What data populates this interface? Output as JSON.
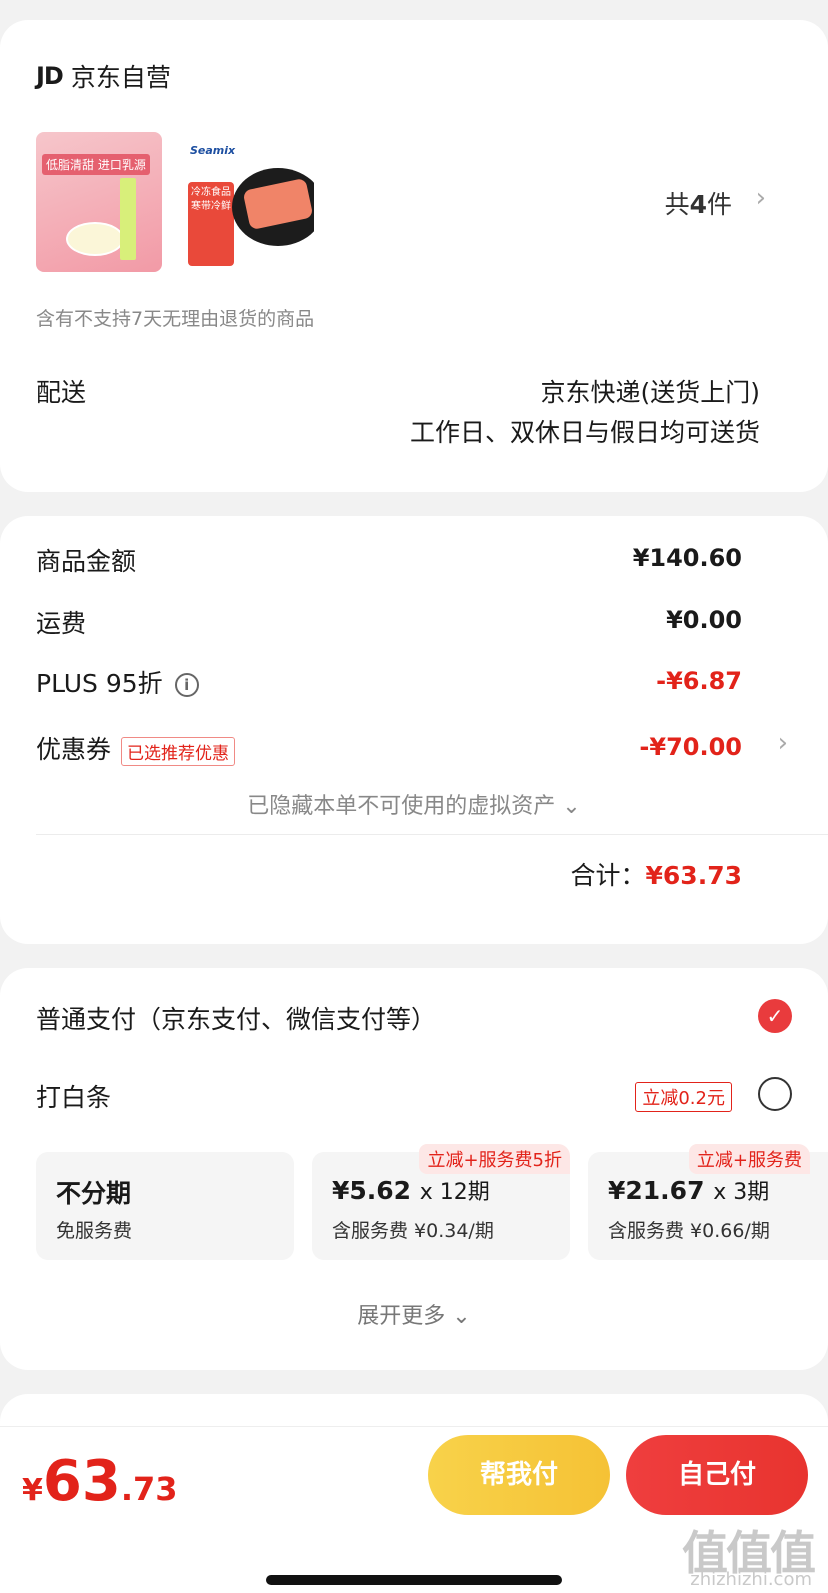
{
  "shop": {
    "logo": "JD",
    "name": "京东自营",
    "thumb1_text": "低脂清甜 进口乳源",
    "thumb2_brand": "Seamix",
    "thumb2_text": "冷冻食品 寒带冷鲜",
    "item_count_prefix": "共",
    "item_count": "4",
    "item_count_suffix": "件",
    "notice": "含有不支持7天无理由退货的商品",
    "shipping_label": "配送",
    "shipping_method": "京东快递(送货上门)",
    "shipping_time": "工作日、双休日与假日均可送货"
  },
  "price": {
    "goods_label": "商品金额",
    "goods_value": "¥140.60",
    "freight_label": "运费",
    "freight_value": "¥0.00",
    "plus_label": "PLUS 95折",
    "plus_value": "-¥6.87",
    "coupon_label": "优惠券",
    "coupon_tag": "已选推荐优惠",
    "coupon_value": "-¥70.00",
    "hidden_assets": "已隐藏本单不可使用的虚拟资产 ⌄",
    "total_label": "合计：",
    "total_value": "¥63.73"
  },
  "payment": {
    "normal_label": "普通支付（京东支付、微信支付等）",
    "baitiao_label": "打白条",
    "baitiao_tag": "立减0.2元",
    "plans": [
      {
        "main": "不分期",
        "sub": "免服务费",
        "badge": ""
      },
      {
        "main": "¥5.62",
        "times": "x 12期",
        "sub": "含服务费 ¥0.34/期",
        "badge": "立减+服务费5折"
      },
      {
        "main": "¥21.67",
        "times": "x 3期",
        "sub": "含服务费 ¥0.66/期",
        "badge": "立减+服务费"
      }
    ],
    "expand_more": "展开更多 ⌄"
  },
  "footer": {
    "currency": "¥",
    "price_int": "63",
    "price_dec": ".73",
    "help_pay": "帮我付",
    "self_pay": "自己付",
    "watermark": "值值值",
    "watermark_sub": "zhizhizhi.com"
  },
  "colors": {
    "accent_red": "#e2231a",
    "help_button": "#f5c235",
    "self_button": "#e8342f"
  }
}
